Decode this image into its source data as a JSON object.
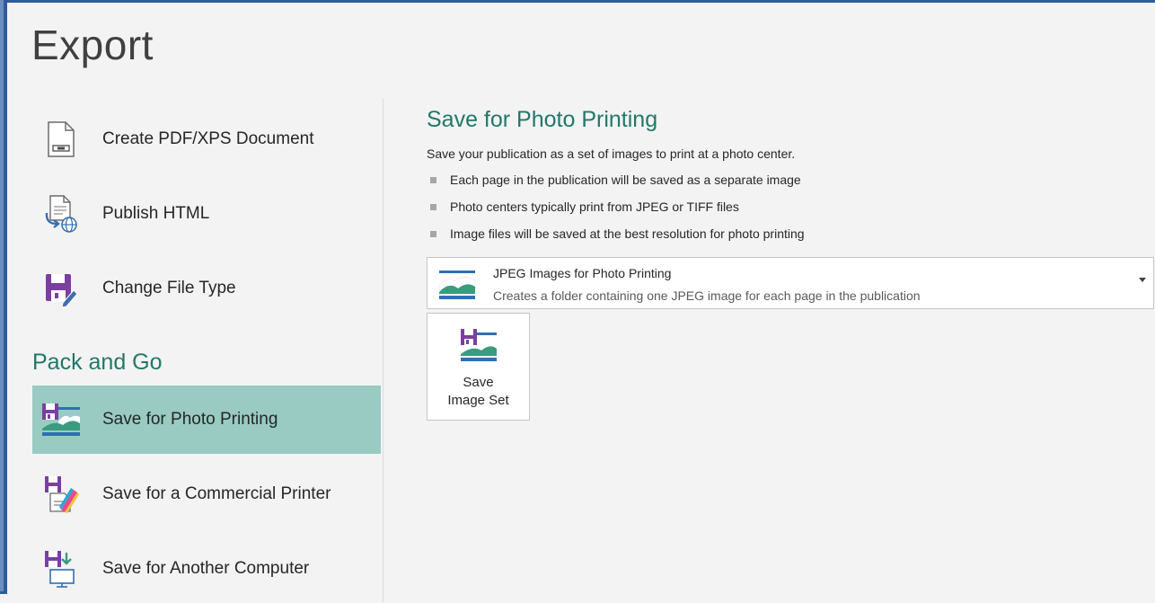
{
  "page": {
    "title": "Export"
  },
  "left_nav": {
    "items": [
      {
        "label": "Create PDF/XPS Document",
        "icon": "pdf-document-icon"
      },
      {
        "label": "Publish HTML",
        "icon": "publish-html-icon"
      },
      {
        "label": "Change File Type",
        "icon": "change-file-type-icon"
      }
    ],
    "section_heading": "Pack and Go",
    "pack_items": [
      {
        "label": "Save for Photo Printing",
        "icon": "photo-printing-icon",
        "selected": true
      },
      {
        "label": "Save for a Commercial Printer",
        "icon": "commercial-printer-icon",
        "selected": false
      },
      {
        "label": "Save for Another Computer",
        "icon": "another-computer-icon",
        "selected": false
      }
    ]
  },
  "detail": {
    "title": "Save for Photo Printing",
    "description": "Save your publication as a set of images to print at a photo center.",
    "bullets": [
      "Each page in the publication will be saved as a separate image",
      "Photo centers typically print from JPEG or TIFF files",
      "Image files will be saved at the best resolution for photo printing"
    ],
    "format_select": {
      "title": "JPEG Images for Photo Printing",
      "description": "Creates a folder containing one JPEG image for each page in the publication"
    },
    "save_button": {
      "line1": "Save",
      "line2": "Image Set"
    }
  },
  "colors": {
    "accent_teal": "#21786a",
    "selected_bg": "#99cbc3",
    "window_border": "#2e5c99",
    "purple_disk": "#7a3fa0"
  }
}
